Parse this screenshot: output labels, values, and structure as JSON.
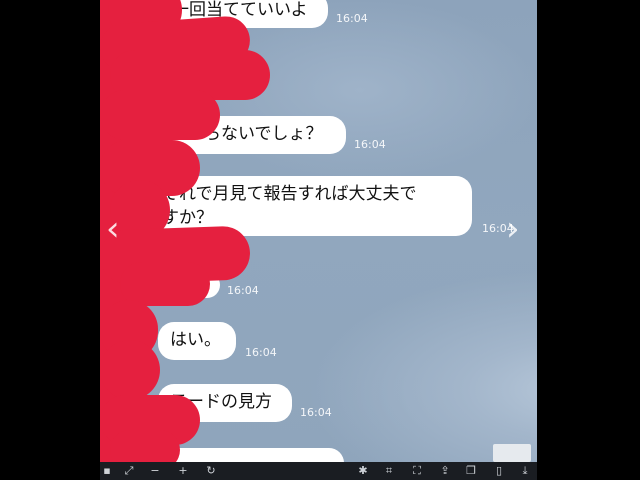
{
  "messages": [
    {
      "text": "一回当てていいよ",
      "time": "16:04"
    },
    {
      "text": "わからないでしょ？",
      "time": "16:04"
    },
    {
      "text": "それで月見て報告すれば大丈夫ですか？",
      "time": "16:04"
    },
    {
      "text": "",
      "time": "16:04"
    },
    {
      "text": "はい。",
      "time": "16:04"
    },
    {
      "text": "モードの見方",
      "time": "16:04"
    }
  ],
  "msg3_line1": "それで月見て報告すれば大丈夫で",
  "msg3_line2": "すか？",
  "nav": {
    "prev": "‹",
    "next": "›"
  },
  "toolbar_icons": [
    "grid-icon",
    "expand-icon",
    "minus-icon",
    "plus-icon",
    "rotate-icon",
    "magic-icon",
    "crop-icon",
    "fit-icon",
    "share-icon",
    "copy-icon",
    "bookmark-icon",
    "download-icon"
  ],
  "colors": {
    "bubble": "#ffffff",
    "background": "#8fa5bc",
    "scribble": "#e5203f"
  }
}
